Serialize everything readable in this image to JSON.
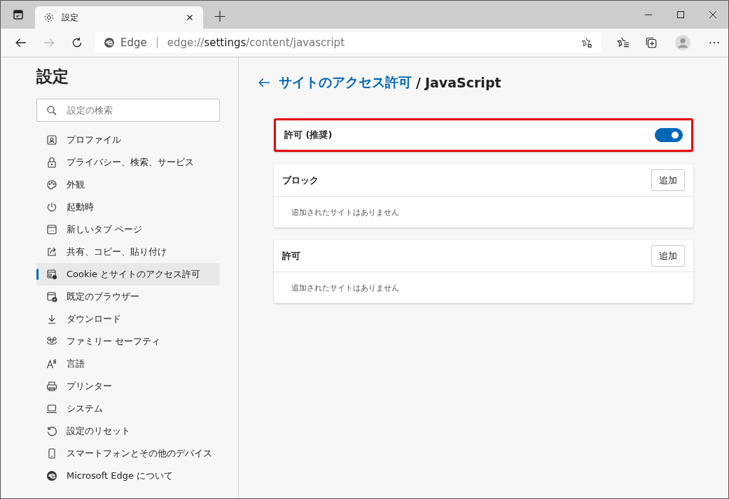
{
  "tab_strip": {
    "tab": {
      "title": "設定",
      "selected": true
    },
    "new_tab": "+"
  },
  "toolbar": {
    "site_label": "Edge",
    "url": {
      "scheme": "edge://",
      "host": "settings",
      "path": "/content/javascript"
    }
  },
  "sidebar": {
    "title": "設定",
    "search": {
      "placeholder": "設定の検索"
    },
    "items": [
      {
        "label": "プロファイル",
        "kind": "profile",
        "selected": false
      },
      {
        "label": "プライバシー、検索、サービス",
        "kind": "lock",
        "selected": false
      },
      {
        "label": "外観",
        "kind": "palette",
        "selected": false
      },
      {
        "label": "起動時",
        "kind": "power",
        "selected": false
      },
      {
        "label": "新しいタブ ページ",
        "kind": "newtab",
        "selected": false
      },
      {
        "label": "共有、コピー、貼り付け",
        "kind": "share",
        "selected": false
      },
      {
        "label": "Cookie とサイトのアクセス許可",
        "kind": "cookie",
        "selected": true
      },
      {
        "label": "既定のブラウザー",
        "kind": "browser",
        "selected": false
      },
      {
        "label": "ダウンロード",
        "kind": "download",
        "selected": false
      },
      {
        "label": "ファミリー セーフティ",
        "kind": "family",
        "selected": false
      },
      {
        "label": "言語",
        "kind": "language",
        "selected": false
      },
      {
        "label": "プリンター",
        "kind": "printer",
        "selected": false
      },
      {
        "label": "システム",
        "kind": "laptop",
        "selected": false
      },
      {
        "label": "設定のリセット",
        "kind": "reset",
        "selected": false
      },
      {
        "label": "スマートフォンとその他のデバイス",
        "kind": "phone",
        "selected": false
      },
      {
        "label": "Microsoft Edge について",
        "kind": "edge",
        "selected": false
      }
    ]
  },
  "main": {
    "breadcrumb": {
      "parent": "サイトのアクセス許可",
      "separator": "/",
      "current": "JavaScript"
    },
    "toggle_card": {
      "label": "許可 (推奨)",
      "on": true,
      "highlighted": true
    },
    "lists": [
      {
        "title": "ブロック",
        "add_button": "追加",
        "empty_text": "追加されたサイトはありません"
      },
      {
        "title": "許可",
        "add_button": "追加",
        "empty_text": "追加されたサイトはありません"
      }
    ]
  }
}
